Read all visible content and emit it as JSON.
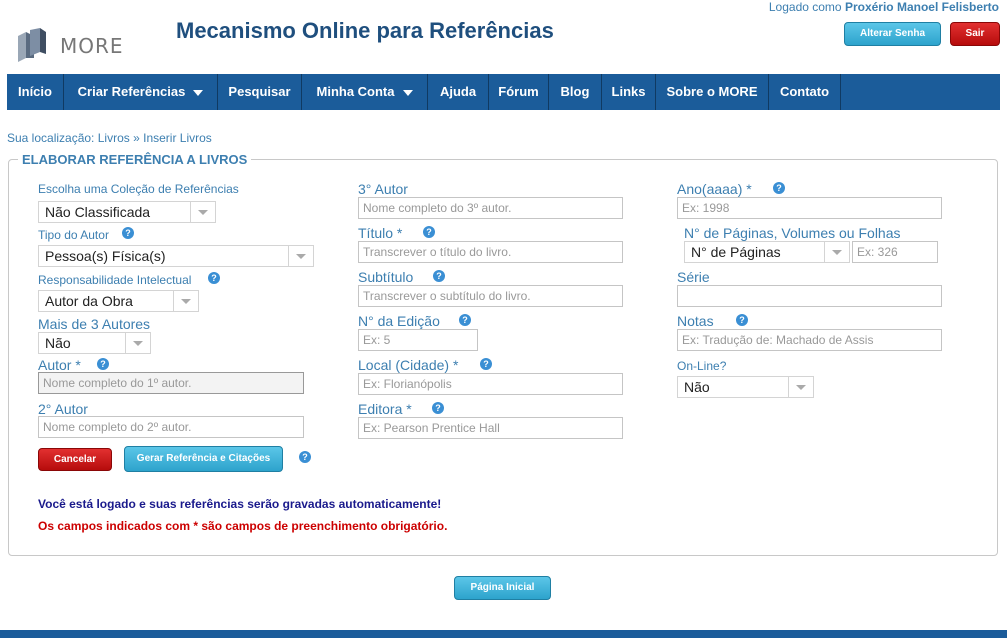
{
  "header": {
    "logo_text": "MORE",
    "title": "Mecanismo Online para Referências",
    "logged_prefix": "Logado como",
    "user_name": "Proxério Manoel Felisberto",
    "change_password": "Alterar Senha",
    "logout": "Sair"
  },
  "nav": {
    "items": [
      "Início",
      "Criar Referências",
      "Pesquisar",
      "Minha Conta",
      "Ajuda",
      "Fórum",
      "Blog",
      "Links",
      "Sobre o MORE",
      "Contato"
    ]
  },
  "breadcrumb": {
    "prefix": "Sua localização:",
    "path1": "Livros",
    "sep": "»",
    "path2": "Inserir Livros"
  },
  "form": {
    "title": "ELABORAR REFERÊNCIA A LIVROS",
    "colecao_label": "Escolha uma Coleção de Referências",
    "colecao_value": "Não Classificada",
    "tipo_autor_label": "Tipo do Autor",
    "tipo_autor_value": "Pessoa(s) Física(s)",
    "resp_label": "Responsabilidade Intelectual",
    "resp_value": "Autor da Obra",
    "mais3_label": "Mais de 3 Autores",
    "mais3_value": "Não",
    "autor_label": "Autor *",
    "autor_ph": "Nome completo do 1º autor.",
    "autor2_label": "2° Autor",
    "autor2_ph": "Nome completo do 2º autor.",
    "autor3_label": "3° Autor",
    "autor3_ph": "Nome completo do 3º autor.",
    "titulo_label": "Título *",
    "titulo_ph": "Transcrever o título do livro.",
    "subtitulo_label": "Subtítulo",
    "subtitulo_ph": "Transcrever o subtítulo do livro.",
    "edicao_label": "N° da Edição",
    "edicao_ph": "Ex: 5",
    "local_label": "Local (Cidade) *",
    "local_ph": "Ex: Florianópolis",
    "editora_label": "Editora *",
    "editora_ph": "Ex: Pearson Prentice Hall",
    "ano_label": "Ano(aaaa) *",
    "ano_ph": "Ex: 1998",
    "paginas_label": "N° de Páginas, Volumes ou Folhas",
    "paginas_select": "N° de Páginas",
    "paginas_ph": "Ex: 326",
    "serie_label": "Série",
    "notas_label": "Notas",
    "notas_ph": "Ex: Tradução de: Machado de Assis",
    "online_label": "On-Line?",
    "online_value": "Não",
    "cancel": "Cancelar",
    "generate": "Gerar Referência e Citações",
    "msg_logged": "Você está logado e suas referências serão gravadas automaticamente!",
    "msg_required": "Os campos indicados com * são campos de preenchimento obrigatório."
  },
  "footer": {
    "home": "Página Inicial"
  },
  "help_glyph": "?"
}
